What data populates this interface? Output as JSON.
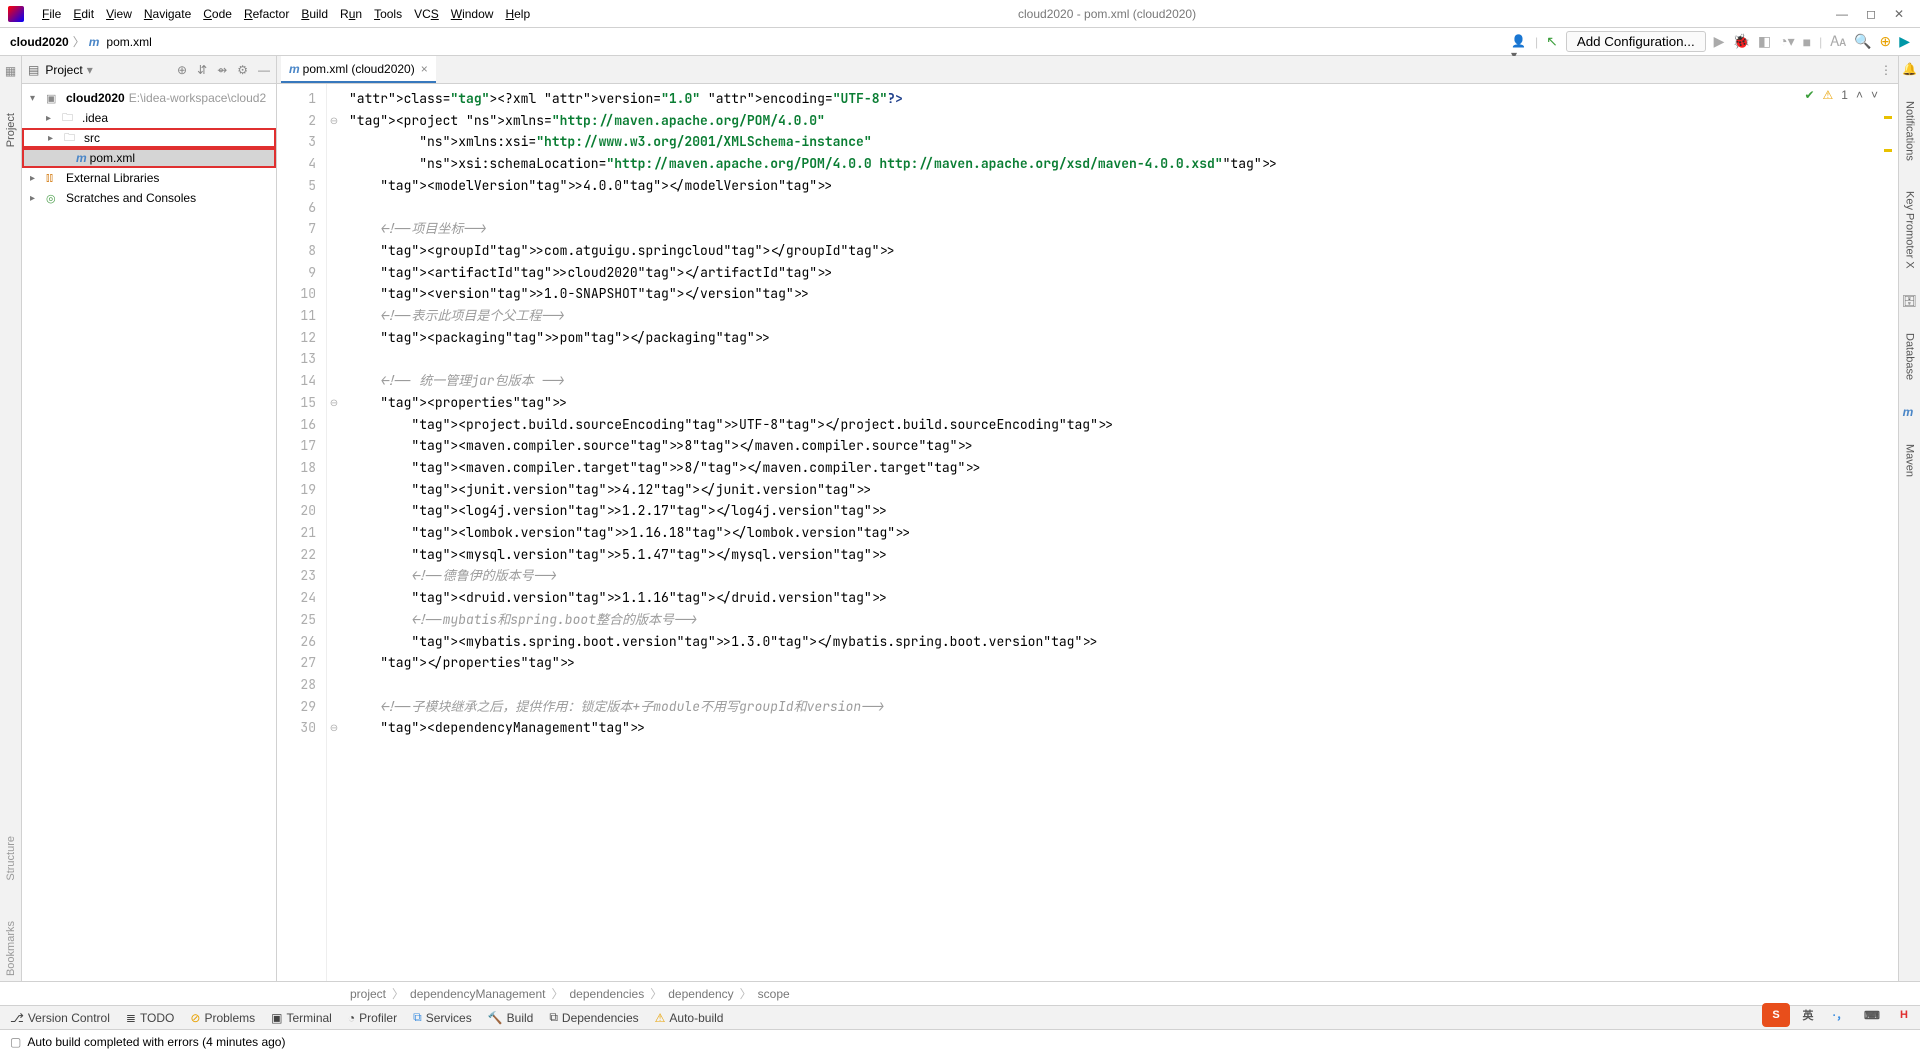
{
  "window": {
    "title": "cloud2020 - pom.xml (cloud2020)"
  },
  "menu": {
    "file": "File",
    "edit": "Edit",
    "view": "View",
    "navigate": "Navigate",
    "code": "Code",
    "refactor": "Refactor",
    "build": "Build",
    "run": "Run",
    "tools": "Tools",
    "vcs": "VCS",
    "window": "Window",
    "help": "Help"
  },
  "breadcrumb": {
    "project": "cloud2020",
    "file": "pom.xml"
  },
  "toolbar": {
    "config": "Add Configuration..."
  },
  "leftTabs": {
    "project": "Project",
    "structure": "Structure",
    "bookmarks": "Bookmarks"
  },
  "rightTabs": {
    "notifications": "Notifications",
    "keypromoter": "Key Promoter X",
    "database": "Database",
    "maven": "Maven"
  },
  "projectPanel": {
    "title": "Project",
    "root": "cloud2020",
    "rootPath": "E:\\idea-workspace\\cloud2",
    "idea": ".idea",
    "src": "src",
    "pom": "pom.xml",
    "extLib": "External Libraries",
    "scratches": "Scratches and Consoles"
  },
  "editor": {
    "tabTitle": "pom.xml (cloud2020)",
    "problems": "1"
  },
  "code": {
    "lines": [
      "<?xml version=\"1.0\" encoding=\"UTF-8\"?>",
      "<project xmlns=\"http://maven.apache.org/POM/4.0.0\"",
      "         xmlns:xsi=\"http://www.w3.org/2001/XMLSchema-instance\"",
      "         xsi:schemaLocation=\"http://maven.apache.org/POM/4.0.0 http://maven.apache.org/xsd/maven-4.0.0.xsd\">",
      "    <modelVersion>4.0.0</modelVersion>",
      "",
      "    <!--项目坐标-->",
      "    <groupId>com.atguigu.springcloud</groupId>",
      "    <artifactId>cloud2020</artifactId>",
      "    <version>1.0-SNAPSHOT</version>",
      "    <!--表示此项目是个父工程-->",
      "    <packaging>pom</packaging>",
      "",
      "    <!-- 统一管理jar包版本 -->",
      "    <properties>",
      "        <project.build.sourceEncoding>UTF-8</project.build.sourceEncoding>",
      "        <maven.compiler.source>8</maven.compiler.source>",
      "        <maven.compiler.target>8/</maven.compiler.target>",
      "        <junit.version>4.12</junit.version>",
      "        <log4j.version>1.2.17</log4j.version>",
      "        <lombok.version>1.16.18</lombok.version>",
      "        <mysql.version>5.1.47</mysql.version>",
      "        <!--德鲁伊的版本号-->",
      "        <druid.version>1.1.16</druid.version>",
      "        <!--mybatis和spring.boot整合的版本号-->",
      "        <mybatis.spring.boot.version>1.3.0</mybatis.spring.boot.version>",
      "    </properties>",
      "",
      "    <!--子模块继承之后，提供作用：锁定版本+子module不用写groupId和version-->",
      "    <dependencyManagement>"
    ]
  },
  "navTrail": [
    "project",
    "dependencyManagement",
    "dependencies",
    "dependency",
    "scope"
  ],
  "bottomTools": {
    "vc": "Version Control",
    "todo": "TODO",
    "problems": "Problems",
    "terminal": "Terminal",
    "profiler": "Profiler",
    "services": "Services",
    "build": "Build",
    "dependencies": "Dependencies",
    "autobuild": "Auto-build"
  },
  "status": {
    "message": "Auto build completed with errors (4 minutes ago)"
  }
}
